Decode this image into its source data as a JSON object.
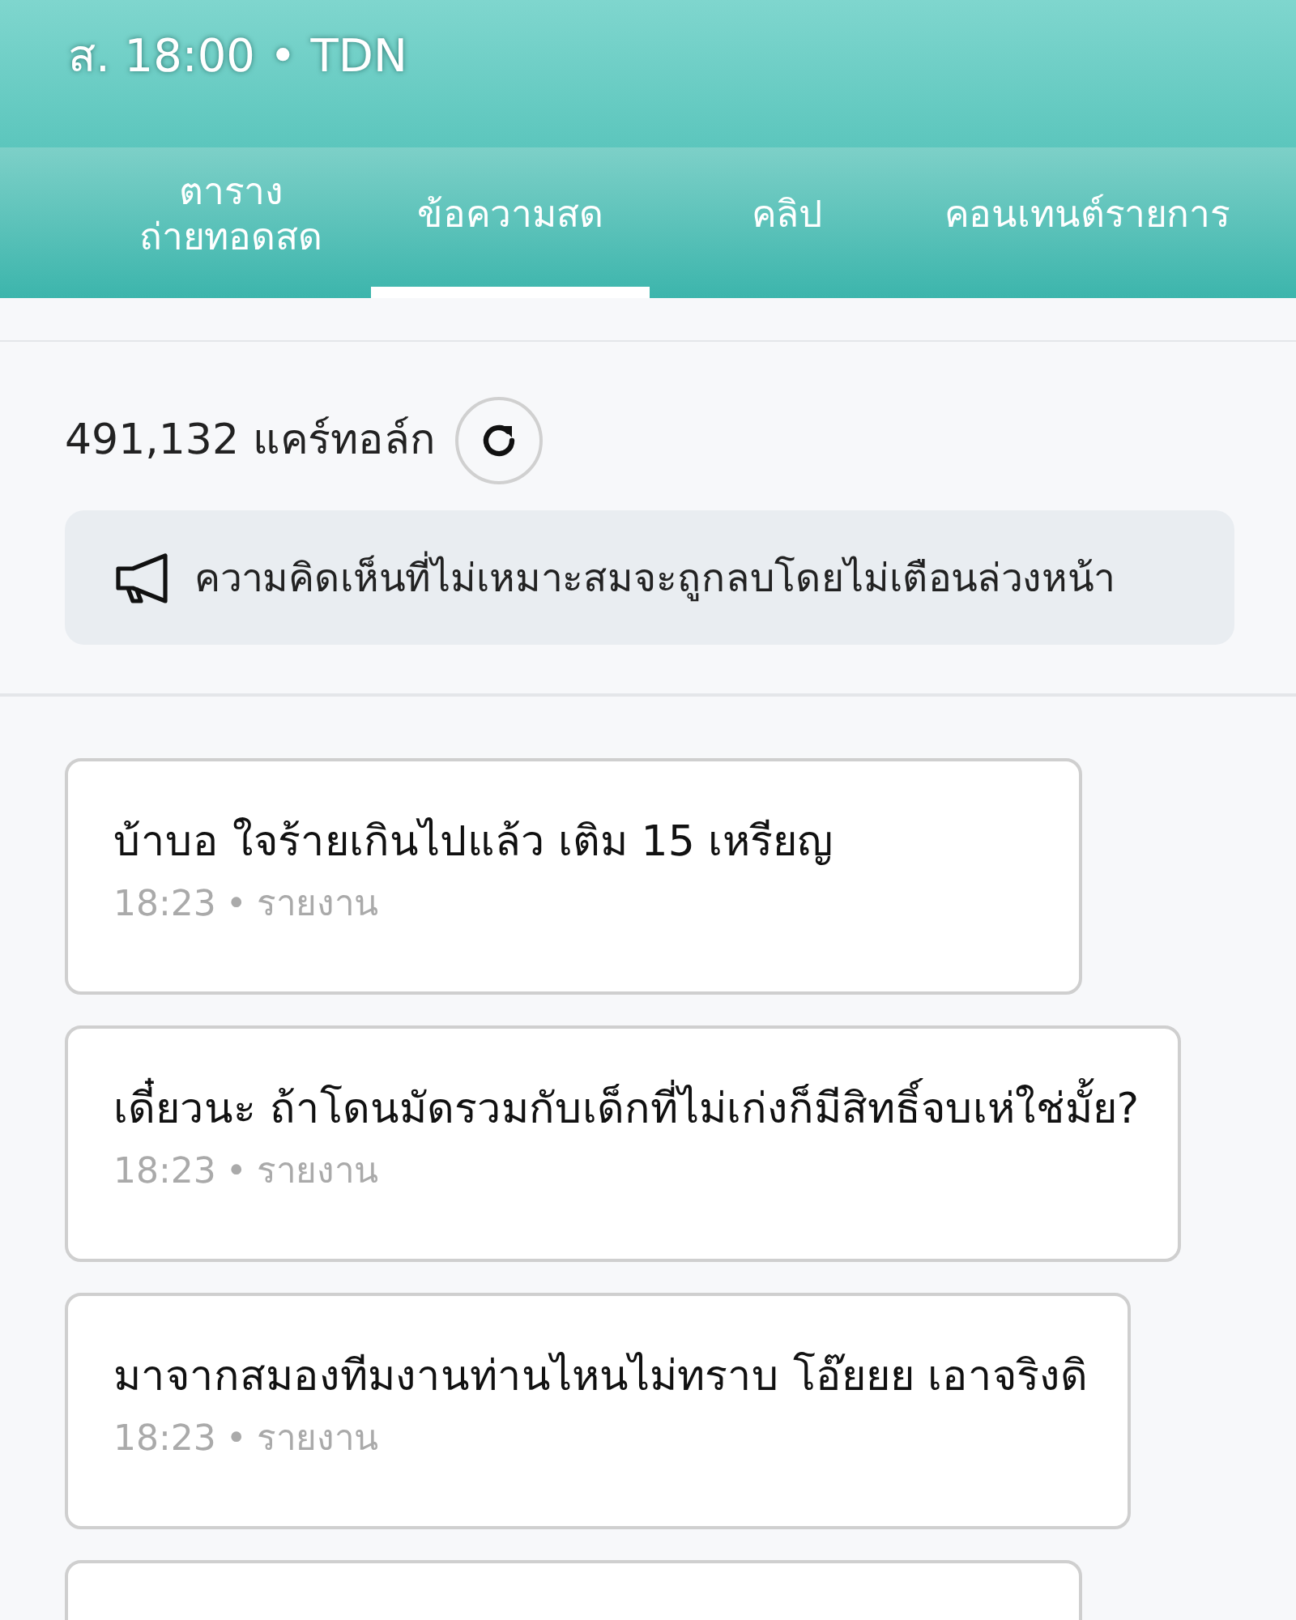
{
  "header": {
    "subtitle": "ส. 18:00 • TDN"
  },
  "tabs": [
    {
      "label": "ตาราง\nถ่ายทอดสด",
      "selected": false
    },
    {
      "label": "ข้อความสด",
      "selected": true
    },
    {
      "label": "คลิป",
      "selected": false
    },
    {
      "label": "คอนเทนต์รายการ",
      "selected": false
    }
  ],
  "count": "491,132 แคร์ทอล์ก",
  "notice": "ความคิดเห็นที่ไม่เหมาะสมจะถูกลบโดยไม่เตือนล่วงหน้า",
  "messages": [
    {
      "kind": "message",
      "text": "บ้าบอ ใจร้ายเกินไปแล้ว เติม 15 เหรียญ",
      "time": "18:23",
      "separator": "•",
      "action": "รายงาน"
    },
    {
      "kind": "message",
      "text": "เดี๋ยวนะ ถ้าโดนมัดรวมกับเด็กที่ไม่เก่งก็มีสิทธิ์จบเห่ใช่มั้ย?",
      "time": "18:23",
      "separator": "•",
      "action": "รายงาน"
    },
    {
      "kind": "message",
      "text": "มาจากสมองทีมงานท่านไหนไม่ทราบ โอ๊ยยย เอาจริงดิ",
      "time": "18:23",
      "separator": "•",
      "action": "รายงาน"
    },
    {
      "kind": "cut"
    }
  ]
}
